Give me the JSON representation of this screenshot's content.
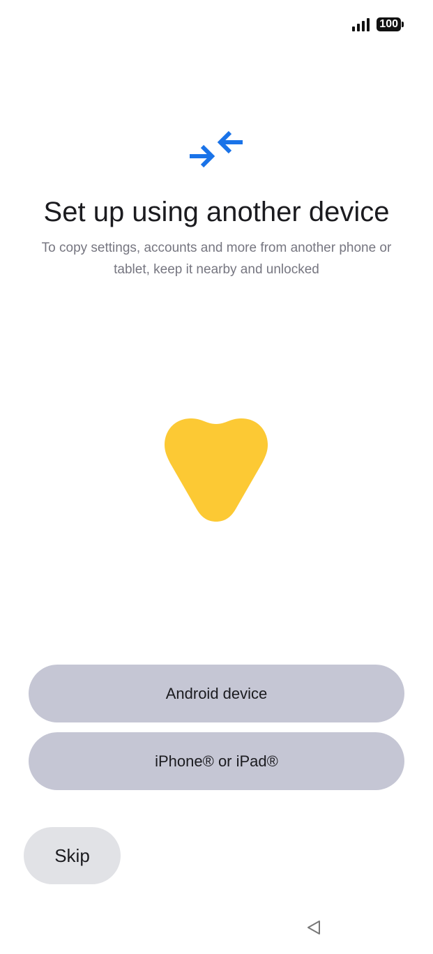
{
  "status_bar": {
    "signal_icon": "cellular-signal-icon",
    "battery_level": "100"
  },
  "header": {
    "icon": "arrows-converge-icon",
    "icon_color": "#1a73e8",
    "title": "Set up using another device",
    "subtitle": "To copy settings, accounts and more from another phone or tablet, keep it nearby and unlocked"
  },
  "illustration": {
    "shape": "yellow-heart-shape",
    "color": "#fcc934"
  },
  "options": {
    "android_label": "Android device",
    "iphone_label": "iPhone® or iPad®"
  },
  "footer": {
    "skip_label": "Skip"
  },
  "nav_bar": {
    "back_icon": "back-triangle-icon"
  },
  "colors": {
    "option_button_bg": "#c5c6d4",
    "skip_button_bg": "#e1e2e6",
    "subtitle_text": "#767680"
  }
}
